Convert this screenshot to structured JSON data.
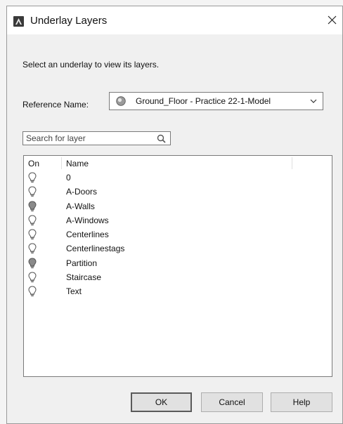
{
  "window": {
    "title": "Underlay Layers",
    "close_icon": "close-icon",
    "app_icon": "autocad-app-icon"
  },
  "instruction": "Select an underlay to view its layers.",
  "reference": {
    "label": "Reference Name:",
    "value": "Ground_Floor - Practice 22-1-Model",
    "icon": "globe-icon"
  },
  "search": {
    "placeholder": "Search for layer",
    "value": "",
    "icon": "search-icon"
  },
  "list": {
    "headers": {
      "on": "On",
      "name": "Name"
    },
    "rows": [
      {
        "name": "0",
        "on": true
      },
      {
        "name": "A-Doors",
        "on": true
      },
      {
        "name": "A-Walls",
        "on": false
      },
      {
        "name": "A-Windows",
        "on": true
      },
      {
        "name": "Centerlines",
        "on": true
      },
      {
        "name": "Centerlinestags",
        "on": true
      },
      {
        "name": "Partition",
        "on": false
      },
      {
        "name": "Staircase",
        "on": true
      },
      {
        "name": "Text",
        "on": true
      }
    ]
  },
  "buttons": {
    "ok": "OK",
    "cancel": "Cancel",
    "help": "Help"
  },
  "colors": {
    "bulb_on": "#ffffff",
    "bulb_off": "#8a8a8a"
  }
}
